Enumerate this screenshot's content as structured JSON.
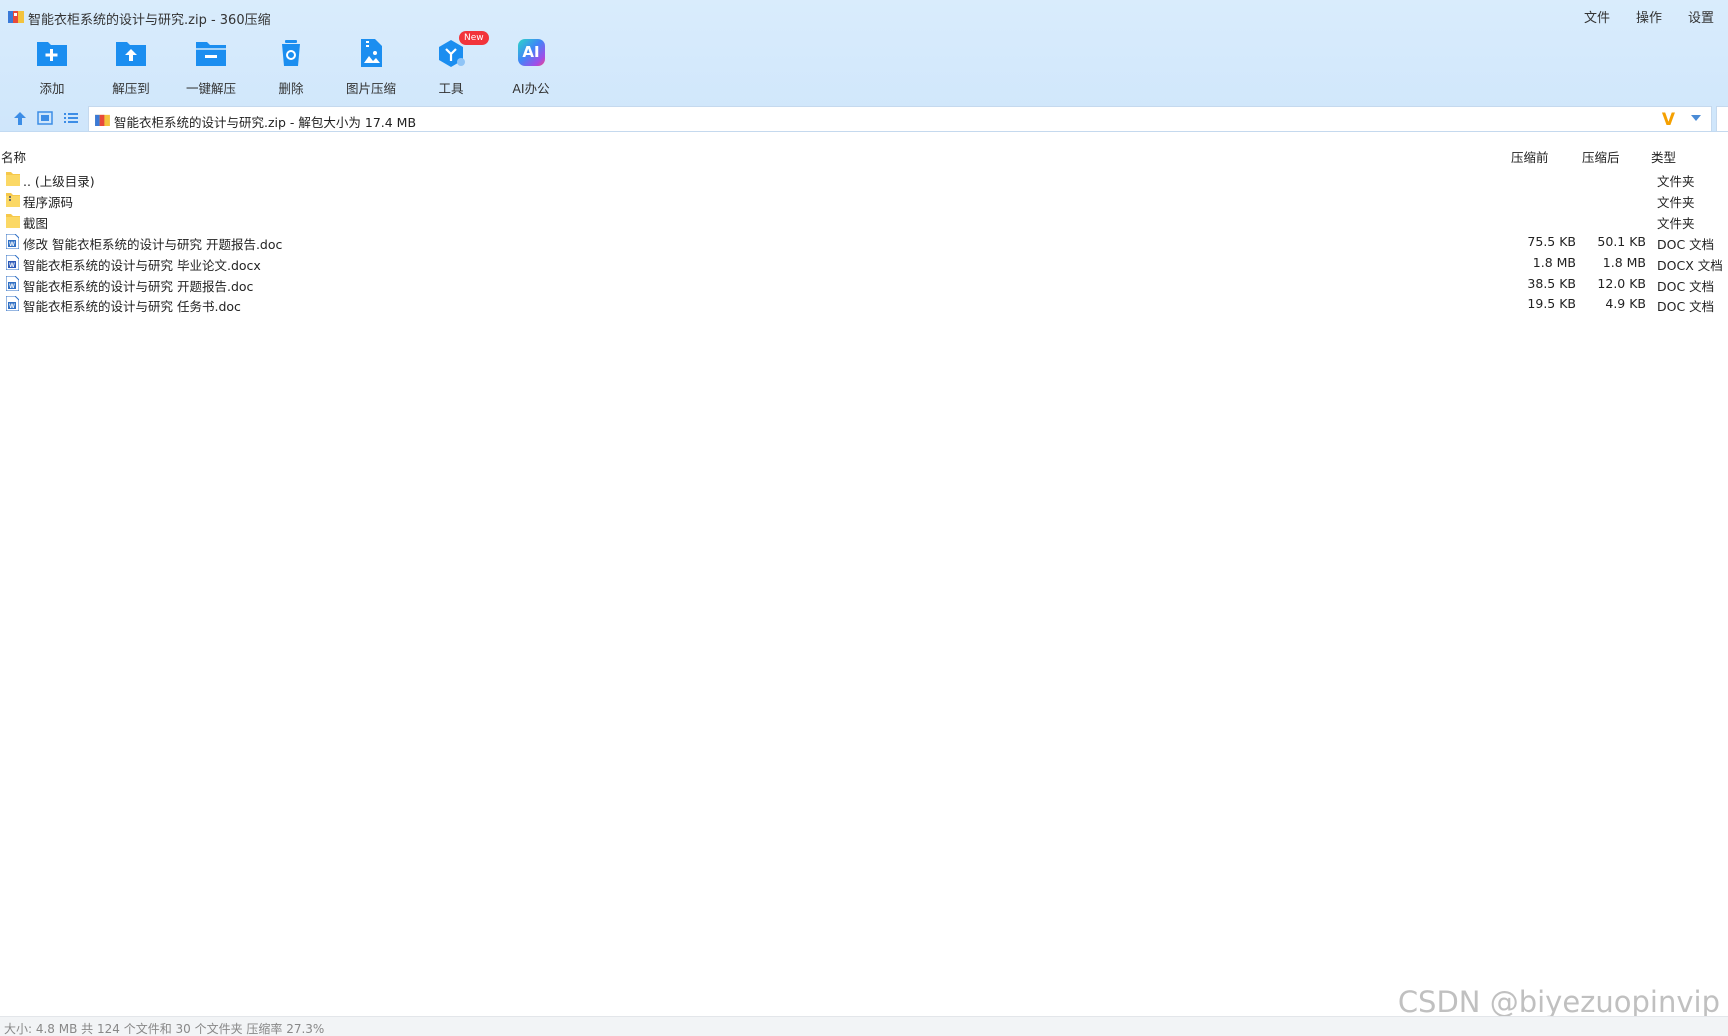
{
  "window": {
    "title": "智能衣柜系统的设计与研究.zip - 360压缩"
  },
  "menu": {
    "file": "文件",
    "operate": "操作",
    "settings": "设置"
  },
  "toolbar": {
    "add": "添加",
    "extract_to": "解压到",
    "one_click_extract": "一键解压",
    "delete": "删除",
    "image_compress": "图片压缩",
    "tools": "工具",
    "tools_badge": "New",
    "ai_office": "AI办公",
    "ai_icon_text": "AI"
  },
  "address": {
    "text": "智能衣柜系统的设计与研究.zip - 解包大小为 17.4 MB",
    "brand": "V"
  },
  "columns": {
    "name": "名称",
    "before": "压缩前",
    "after": "压缩后",
    "type": "类型"
  },
  "files": [
    {
      "name": ".. (上级目录)",
      "before": "",
      "after": "",
      "type": "文件夹",
      "kind": "folder"
    },
    {
      "name": "程序源码",
      "before": "",
      "after": "",
      "type": "文件夹",
      "kind": "folder-zip"
    },
    {
      "name": "截图",
      "before": "",
      "after": "",
      "type": "文件夹",
      "kind": "folder"
    },
    {
      "name": "修改 智能衣柜系统的设计与研究 开题报告.doc",
      "before": "75.5 KB",
      "after": "50.1 KB",
      "type": "DOC 文档",
      "kind": "doc"
    },
    {
      "name": "智能衣柜系统的设计与研究 毕业论文.docx",
      "before": "1.8 MB",
      "after": "1.8 MB",
      "type": "DOCX 文档",
      "kind": "docx"
    },
    {
      "name": "智能衣柜系统的设计与研究 开题报告.doc",
      "before": "38.5 KB",
      "after": "12.0 KB",
      "type": "DOC 文档",
      "kind": "doc"
    },
    {
      "name": "智能衣柜系统的设计与研究 任务书.doc",
      "before": "19.5 KB",
      "after": "4.9 KB",
      "type": "DOC 文档",
      "kind": "doc"
    }
  ],
  "status": {
    "text": "大小: 4.8 MB 共 124 个文件和 30 个文件夹 压缩率 27.3%"
  },
  "watermark": "CSDN @biyezuopinvip",
  "colors": {
    "accent": "#1b8ef0",
    "toolbar_bg": "#d9ecfc",
    "badge": "#f2343b",
    "brand_v": "#f5a000"
  }
}
